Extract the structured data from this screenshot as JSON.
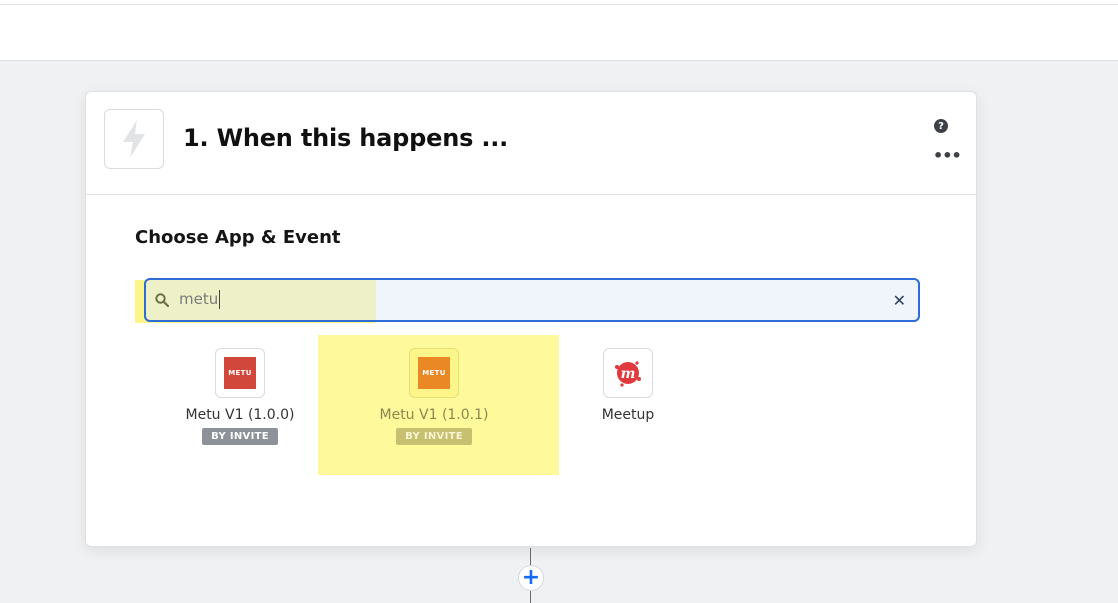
{
  "step": {
    "title": "1. When this happens ...",
    "section_title": "Choose App & Event"
  },
  "search": {
    "value": "metu"
  },
  "results": [
    {
      "name": "Metu V1 (1.0.0)",
      "badge": "BY INVITE",
      "logo_text": "METU",
      "logo_color": "#d1473b"
    },
    {
      "name": "Metu V1 (1.0.1)",
      "badge": "BY INVITE",
      "logo_text": "METU",
      "logo_color": "#e98824"
    },
    {
      "name": "Meetup",
      "badge": "",
      "logo_color": "#e0393e"
    }
  ],
  "icons": {
    "trigger": "lightning-bolt-icon",
    "help": "question-circle-icon",
    "more": "ellipsis-icon",
    "search": "search-icon",
    "clear": "close-icon",
    "add_step": "plus-icon"
  },
  "colors": {
    "accent": "#136bf5",
    "highlight": "#fbf58a"
  }
}
